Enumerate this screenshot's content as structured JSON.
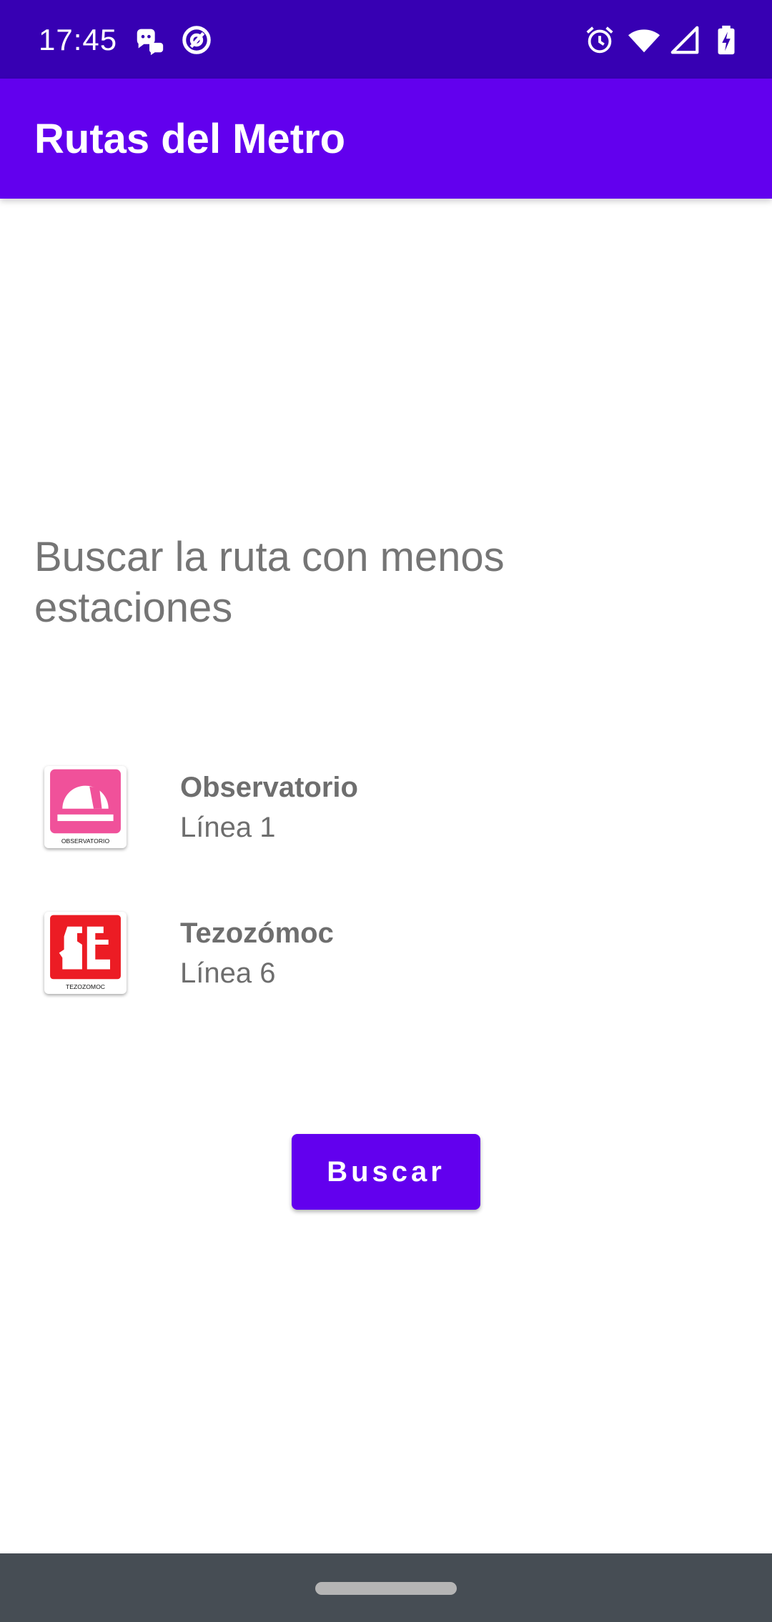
{
  "status_bar": {
    "time": "17:45",
    "icons": [
      "discord-notification-icon",
      "assistant-icon",
      "alarm-icon",
      "wifi-icon",
      "cell-signal-icon",
      "battery-charging-icon"
    ]
  },
  "app_bar": {
    "title": "Rutas del Metro"
  },
  "main": {
    "prompt": "Buscar la ruta con menos estaciones",
    "stations": [
      {
        "name": "Observatorio",
        "line": "Línea 1",
        "logo_caption": "OBSERVATORIO",
        "logo_color": "#f0519a",
        "icon": "observatory-icon"
      },
      {
        "name": "Tezozómoc",
        "line": "Línea 6",
        "logo_caption": "TEZOZOMOC",
        "logo_color": "#ec1c24",
        "icon": "tezozomoc-icon"
      }
    ],
    "search_button": "Buscar"
  },
  "colors": {
    "status_bar": "#3700b3",
    "app_bar": "#6200ee",
    "button": "#6200ee",
    "nav_bar": "#464d54",
    "text_secondary": "#757575"
  }
}
